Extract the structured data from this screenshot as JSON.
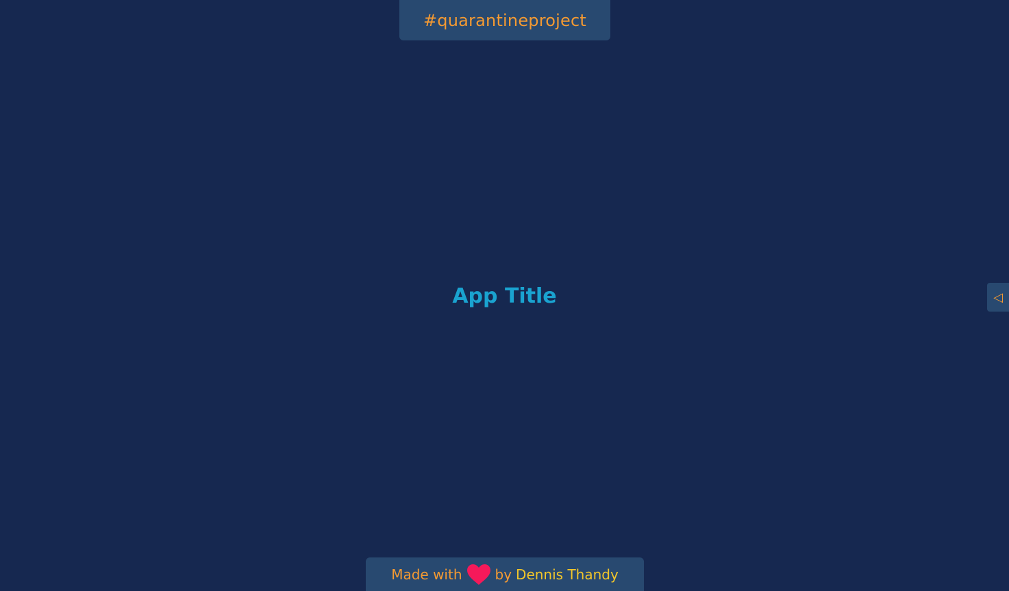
{
  "header": {
    "tag_text": "#quarantineproject"
  },
  "main": {
    "title": "App Title"
  },
  "side_panel": {
    "toggle_glyph": "◁"
  },
  "footer": {
    "made_with": "Made with",
    "heart_icon": "heart-icon",
    "by": "by",
    "author": "Dennis Thandy"
  },
  "colors": {
    "background": "#162850",
    "panel": "#284970",
    "accent_orange": "#f49a32",
    "title_blue": "#1aa3d0",
    "author_yellow": "#f2c62a",
    "heart_red": "#f5195a"
  }
}
